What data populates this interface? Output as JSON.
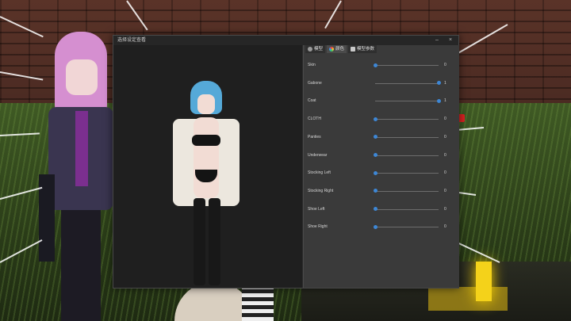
{
  "window": {
    "title": "选择设定查看",
    "minimize": "–",
    "close": "×"
  },
  "tabs": [
    {
      "label": "模型",
      "icon": "person-icon",
      "active": false
    },
    {
      "label": "颜色",
      "icon": "palette-icon",
      "active": true
    },
    {
      "label": "模型参数",
      "icon": "gear-icon",
      "active": false
    }
  ],
  "sliders": [
    {
      "label": "Skin",
      "value": "0",
      "level": 0
    },
    {
      "label": "Gabone",
      "value": "1",
      "level": 1
    },
    {
      "label": "Coat",
      "value": "1",
      "level": 1
    },
    {
      "label": "CLOTH",
      "value": "0",
      "level": 0
    },
    {
      "label": "Panties",
      "value": "0",
      "level": 0
    },
    {
      "label": "Underwear",
      "value": "0",
      "level": 0
    },
    {
      "label": "Stocking Left",
      "value": "0",
      "level": 0
    },
    {
      "label": "Stocking Right",
      "value": "0",
      "level": 0
    },
    {
      "label": "Shoe Left",
      "value": "0",
      "level": 0
    },
    {
      "label": "Shoe Right",
      "value": "0",
      "level": 0
    }
  ],
  "colors": {
    "accent": "#3d87d6",
    "panel": "#3a3a3a",
    "preview": "#1f1f1f"
  }
}
